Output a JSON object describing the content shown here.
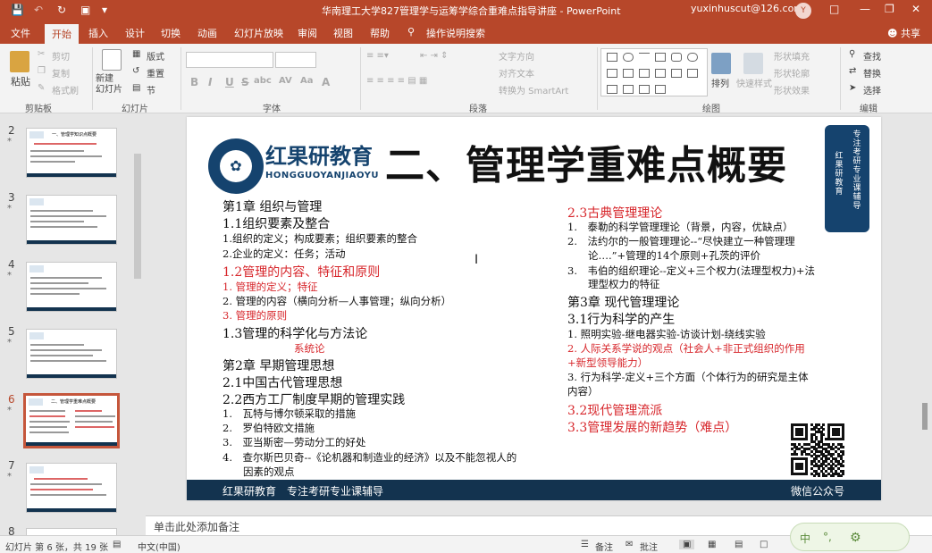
{
  "window": {
    "title": "华南理工大学827管理学与运筹学综合重难点指导讲座 - PowerPoint",
    "user": "yuxinhuscut@126.com",
    "avatar_initial": "Y",
    "share": "共享"
  },
  "tabs": [
    "文件",
    "开始",
    "插入",
    "设计",
    "切换",
    "动画",
    "幻灯片放映",
    "审阅",
    "视图",
    "帮助",
    "操作说明搜索"
  ],
  "active_tab": "开始",
  "ribbon": {
    "clipboard": {
      "paste": "粘贴",
      "cut": "剪切",
      "copy": "复制",
      "format_painter": "格式刷",
      "label": "剪贴板"
    },
    "slides": {
      "new_slide": "新建\n幻灯片",
      "layout": "版式",
      "reset": "重置",
      "section": "节",
      "label": "幻灯片"
    },
    "font": {
      "label": "字体",
      "buttons": [
        "B",
        "I",
        "U",
        "S",
        "abc",
        "AV",
        "Aa",
        "A"
      ]
    },
    "paragraph": {
      "text_direction": "文字方向",
      "align_text": "对齐文本",
      "convert_smartart": "转换为 SmartArt",
      "label": "段落"
    },
    "drawing": {
      "arrange": "排列",
      "quick_styles": "快速样式",
      "shape_fill": "形状填充",
      "shape_outline": "形状轮廓",
      "shape_effects": "形状效果",
      "label": "绘图"
    },
    "editing": {
      "find": "查找",
      "replace": "替换",
      "select": "选择",
      "label": "编辑"
    }
  },
  "thumbnails": [
    {
      "num": "2",
      "title": "一、管理学知识点概要"
    },
    {
      "num": "3",
      "title": ""
    },
    {
      "num": "4",
      "title": ""
    },
    {
      "num": "5",
      "title": ""
    },
    {
      "num": "6",
      "title": "二、管理学重难点概要",
      "active": true
    },
    {
      "num": "7",
      "title": ""
    },
    {
      "num": "8",
      "title": ""
    }
  ],
  "slide": {
    "logo_cn": "红果研教育",
    "logo_en": "HONGGUOYANJIAOYU",
    "title": "二、管理学重难点概要",
    "seal_lines": [
      "专注考研专业课辅导",
      "红果研教育"
    ],
    "left_column": [
      {
        "text": "第1章 组织与管理",
        "style": "h1"
      },
      {
        "text": "1.1组织要素及整合",
        "style": "h2"
      },
      {
        "text": "1.组织的定义；构成要素；组织要素的整合",
        "style": "it"
      },
      {
        "text": "2.企业的定义：任务；活动",
        "style": "it"
      },
      {
        "text": "1.2管理的内容、特征和原则",
        "style": "h2 red"
      },
      {
        "text": "1. 管理的定义；特征",
        "style": "it red"
      },
      {
        "text": "2. 管理的内容（横向分析—人事管理；纵向分析）",
        "style": "it"
      },
      {
        "text": "3. 管理的原则",
        "style": "it red"
      },
      {
        "text": "1.3管理的科学化与方法论",
        "style": "h2"
      },
      {
        "text": "系统论",
        "style": "it red center"
      },
      {
        "text": "第2章 早期管理思想",
        "style": "h1"
      },
      {
        "text": "2.1中国古代管理思想",
        "style": "h2"
      },
      {
        "text": "2.2西方工厂制度早期的管理实践",
        "style": "h2"
      },
      {
        "text": "1.　瓦特与博尔顿采取的措施",
        "style": "it"
      },
      {
        "text": "2.　罗伯特欧文措施",
        "style": "it"
      },
      {
        "text": "3.　亚当斯密—劳动分工的好处",
        "style": "it"
      },
      {
        "text": "4.　查尔斯巴贝奇--《论机器和制造业的经济》以及不能忽视人的",
        "style": "it"
      },
      {
        "text": "　　因素的观点",
        "style": "it"
      }
    ],
    "right_column": [
      {
        "text": "2.3古典管理理论",
        "style": "h2 red"
      },
      {
        "text": "1.　泰勒的科学管理理论（背景，内容，优缺点）",
        "style": "it"
      },
      {
        "text": "2.　法约尔的一般管理理论--“尽快建立一种管理理",
        "style": "it"
      },
      {
        "text": "　　论….”+管理的14个原则+孔茨的评价",
        "style": "it"
      },
      {
        "text": "3.　韦伯的组织理论--定义+三个权力(法理型权力)+法",
        "style": "it"
      },
      {
        "text": "　　理型权力的特征",
        "style": "it"
      },
      {
        "text": "第3章 现代管理理论",
        "style": "h1"
      },
      {
        "text": "3.1行为科学的产生",
        "style": "h2"
      },
      {
        "text": "1. 照明实验-继电器实验-访谈计划-绕线实验",
        "style": "it"
      },
      {
        "text": "2. 人际关系学说的观点（社会人+非正式组织的作用",
        "style": "it red"
      },
      {
        "text": "+新型领导能力）",
        "style": "it red"
      },
      {
        "text": "3. 行为科学-定义+三个方面（个体行为的研究是主体",
        "style": "it"
      },
      {
        "text": "内容）",
        "style": "it"
      },
      {
        "text": "3.2现代管理流派",
        "style": "h2 red"
      },
      {
        "text": "3.3管理发展的新趋势（难点）",
        "style": "h2 red"
      }
    ],
    "footer_left": "红果研教育　专注考研专业课辅导",
    "footer_right": "微信公众号"
  },
  "notes_placeholder": "单击此处添加备注",
  "status": {
    "slide_info": "幻灯片 第 6 张，共 19 张",
    "language": "中文(中国)",
    "notes": "备注",
    "comments": "批注"
  },
  "ime": {
    "mode": "中",
    "punct": "°,"
  }
}
